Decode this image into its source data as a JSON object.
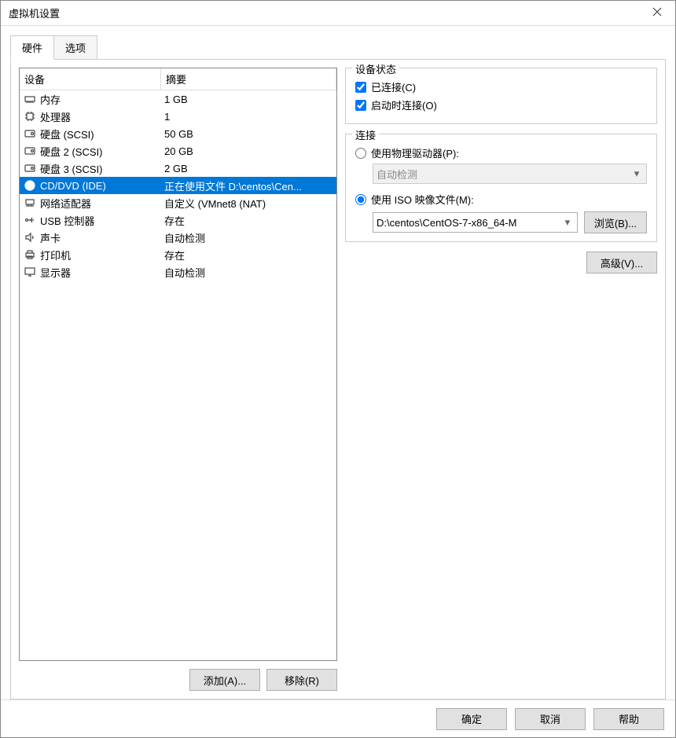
{
  "window": {
    "title": "虚拟机设置"
  },
  "tabs": {
    "hardware": "硬件",
    "options": "选项",
    "active": "hardware"
  },
  "columns": {
    "device": "设备",
    "summary": "摘要"
  },
  "hardware_list": [
    {
      "icon": "memory-icon",
      "device": "内存",
      "summary": "1 GB",
      "selected": false
    },
    {
      "icon": "cpu-icon",
      "device": "处理器",
      "summary": "1",
      "selected": false
    },
    {
      "icon": "disk-icon",
      "device": "硬盘 (SCSI)",
      "summary": "50 GB",
      "selected": false
    },
    {
      "icon": "disk-icon",
      "device": "硬盘 2 (SCSI)",
      "summary": "20 GB",
      "selected": false
    },
    {
      "icon": "disk-icon",
      "device": "硬盘 3 (SCSI)",
      "summary": "2 GB",
      "selected": false
    },
    {
      "icon": "cd-icon",
      "device": "CD/DVD (IDE)",
      "summary": "正在使用文件 D:\\centos\\Cen...",
      "selected": true
    },
    {
      "icon": "network-icon",
      "device": "网络适配器",
      "summary": "自定义 (VMnet8 (NAT)",
      "selected": false
    },
    {
      "icon": "usb-icon",
      "device": "USB 控制器",
      "summary": "存在",
      "selected": false
    },
    {
      "icon": "sound-icon",
      "device": "声卡",
      "summary": "自动检测",
      "selected": false
    },
    {
      "icon": "printer-icon",
      "device": "打印机",
      "summary": "存在",
      "selected": false
    },
    {
      "icon": "display-icon",
      "device": "显示器",
      "summary": "自动检测",
      "selected": false
    }
  ],
  "left_buttons": {
    "add": "添加(A)...",
    "remove": "移除(R)"
  },
  "status_group": {
    "title": "设备状态",
    "connected_label": "已连接(C)",
    "connected_checked": true,
    "connect_at_poweron_label": "启动时连接(O)",
    "connect_at_poweron_checked": true
  },
  "connection_group": {
    "title": "连接",
    "use_physical_label": "使用物理驱动器(P):",
    "use_physical_selected": false,
    "autodetect_label": "自动检测",
    "use_iso_label": "使用 ISO 映像文件(M):",
    "use_iso_selected": true,
    "iso_path": "D:\\centos\\CentOS-7-x86_64-M",
    "browse_label": "浏览(B)..."
  },
  "advanced_label": "高级(V)...",
  "footer": {
    "ok": "确定",
    "cancel": "取消",
    "help": "帮助"
  }
}
